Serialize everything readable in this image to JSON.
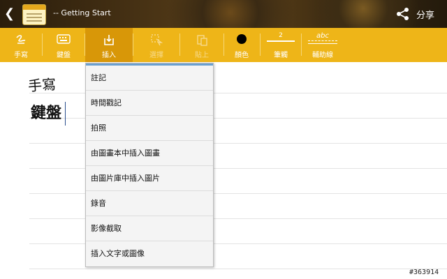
{
  "header": {
    "back_icon": "back-chevron-icon",
    "app_icon": "notebook-icon",
    "title": "-- Getting Start",
    "share_icon": "share-icon",
    "share_label": "分享"
  },
  "toolbar": {
    "background": "#eeb518",
    "items": [
      {
        "label": "手寫",
        "icon": "handwriting-icon",
        "state": "enabled"
      },
      {
        "label": "鍵盤",
        "icon": "keyboard-icon",
        "state": "enabled"
      },
      {
        "label": "插入",
        "icon": "insert-icon",
        "state": "active"
      },
      {
        "label": "選擇",
        "icon": "select-icon",
        "state": "disabled"
      },
      {
        "label": "貼上",
        "icon": "paste-icon",
        "state": "disabled"
      },
      {
        "label": "顏色",
        "icon": "color-dot-icon",
        "state": "enabled"
      },
      {
        "label": "筆觸",
        "icon": "stroke-width-icon",
        "stroke_value": "2",
        "state": "enabled"
      },
      {
        "label": "輔助線",
        "icon": "guide-line-icon",
        "sample_text": "abc",
        "state": "enabled"
      }
    ]
  },
  "canvas": {
    "handwritten_text": "手寫",
    "typed_text": "鍵盤"
  },
  "insert_menu": {
    "items": [
      "註記",
      "時間戳記",
      "拍照",
      "由圖畫本中插入圖畫",
      "由圖片庫中插入圖片",
      "錄音",
      "影像截取",
      "插入文字或圖像"
    ]
  },
  "watermark": "#363914"
}
